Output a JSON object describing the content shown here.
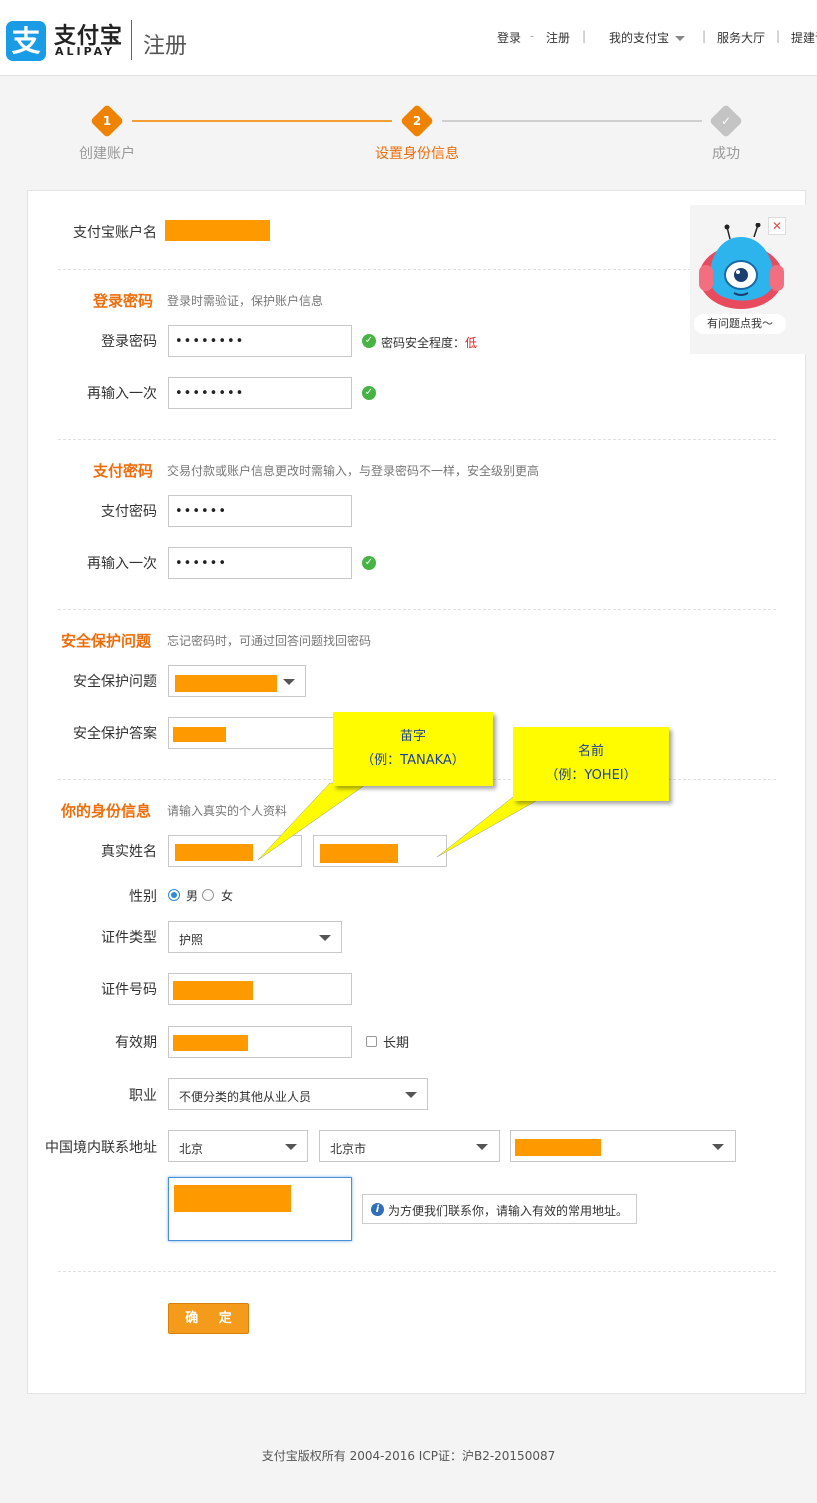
{
  "header": {
    "logo_cn": "支付宝",
    "logo_en": "ALIPAY",
    "page_title": "注册",
    "nav": {
      "login": "登录",
      "register": "注册",
      "my_alipay": "我的支付宝",
      "service_hall": "服务大厅",
      "suggest": "提建议"
    }
  },
  "steps": [
    {
      "num": "1",
      "label": "创建账户"
    },
    {
      "num": "2",
      "label": "设置身份信息"
    },
    {
      "num": "✓",
      "label": "成功"
    }
  ],
  "account": {
    "label": "支付宝账户名"
  },
  "login_pw": {
    "title": "登录密码",
    "desc": "登录时需验证，保护账户信息",
    "pw_label": "登录密码",
    "pw_value": "••••••••",
    "strength_label": "密码安全程度：",
    "strength_value": "低",
    "confirm_label": "再输入一次",
    "confirm_value": "••••••••"
  },
  "pay_pw": {
    "title": "支付密码",
    "desc": "交易付款或账户信息更改时需输入，与登录密码不一样，安全级别更高",
    "pw_label": "支付密码",
    "pw_value": "••••••",
    "confirm_label": "再输入一次",
    "confirm_value": "••••••"
  },
  "security": {
    "title": "安全保护问题",
    "desc": "忘记密码时，可通过回答问题找回密码",
    "question_label": "安全保护问题",
    "answer_label": "安全保护答案"
  },
  "identity": {
    "title": "你的身份信息",
    "desc": "请输入真实的个人资料",
    "name_label": "真实姓名",
    "gender_label": "性别",
    "male": "男",
    "female": "女",
    "id_type_label": "证件类型",
    "id_type_value": "护照",
    "id_no_label": "证件号码",
    "validity_label": "有效期",
    "longterm_label": "长期",
    "job_label": "职业",
    "job_value": "不便分类的其他从业人员",
    "address_label": "中国境内联系地址",
    "province": "北京",
    "city": "北京市",
    "address_tip": "为方便我们联系你，请输入有效的常用地址。"
  },
  "callouts": {
    "surname_title": "苗字",
    "surname_example": "（例：TANAKA）",
    "given_title": "名前",
    "given_example": "（例：YOHEI）"
  },
  "robot": {
    "text": "有问题点我～"
  },
  "confirm_button": "确 定",
  "footer": "支付宝版权所有 2004-2016 ICP证：沪B2-20150087",
  "colors": {
    "brand_blue": "#1a9be6",
    "accent_orange": "#ee6e0d",
    "mask_orange": "#ff9900",
    "callout_yellow": "#fffc00"
  }
}
